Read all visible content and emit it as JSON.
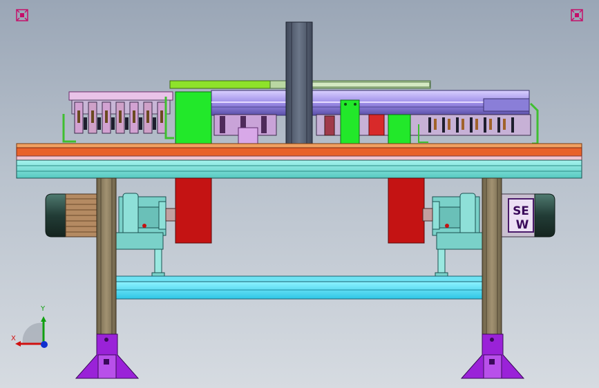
{
  "viewport": {
    "background_top": "#9aa6b6",
    "background_bottom": "#d6dbe1"
  },
  "toolbar": {
    "corner_left_icon": "view-control-icon",
    "corner_right_icon": "view-control-icon"
  },
  "triad": {
    "x_label": "X",
    "y_label": "Y",
    "x_color": "#d01010",
    "y_color": "#10a010",
    "z_color": "#1030d0"
  },
  "model": {
    "motor_badge_line1": "SE",
    "motor_badge_line2": "W",
    "colors": {
      "frame_cyan": "#7fe3dc",
      "table_orange": "#e8622a",
      "legs_olive": "#8e8060",
      "feet_purple": "#9a22d8",
      "gear_teal": "#7ad1c9",
      "motor_dark": "#2c4b45",
      "red_block": "#c41313",
      "green_block": "#22e82a",
      "column_gray": "#5b6577",
      "beam_lavender": "#a99cf0"
    }
  }
}
